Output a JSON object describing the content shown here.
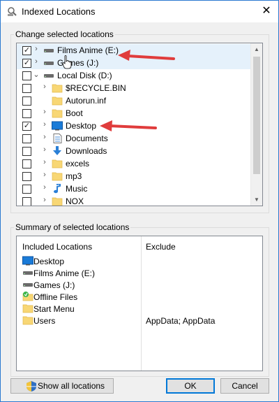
{
  "window": {
    "title": "Indexed Locations",
    "close_glyph": "✕"
  },
  "change_group": {
    "label": "Change selected locations"
  },
  "tree": {
    "rows": [
      {
        "label": "Films Anime (E:)",
        "checked": true,
        "expander": "›",
        "icon": "drive-icon",
        "indent": 1
      },
      {
        "label": "Games (J:)",
        "checked": true,
        "expander": "›",
        "icon": "drive-icon",
        "indent": 1
      },
      {
        "label": "Local Disk (D:)",
        "checked": false,
        "expander": "⌄",
        "icon": "drive-icon",
        "indent": 1
      },
      {
        "label": "$RECYCLE.BIN",
        "checked": false,
        "expander": "›",
        "icon": "folder-icon",
        "indent": 2
      },
      {
        "label": "Autorun.inf",
        "checked": false,
        "expander": "",
        "icon": "folder-icon",
        "indent": 2
      },
      {
        "label": "Boot",
        "checked": false,
        "expander": "›",
        "icon": "folder-icon",
        "indent": 2
      },
      {
        "label": "Desktop",
        "checked": true,
        "expander": "›",
        "icon": "desktop-icon",
        "indent": 2
      },
      {
        "label": "Documents",
        "checked": false,
        "expander": "›",
        "icon": "documents-icon",
        "indent": 2
      },
      {
        "label": "Downloads",
        "checked": false,
        "expander": "›",
        "icon": "downloads-icon",
        "indent": 2
      },
      {
        "label": "excels",
        "checked": false,
        "expander": "›",
        "icon": "folder-icon",
        "indent": 2
      },
      {
        "label": "mp3",
        "checked": false,
        "expander": "›",
        "icon": "folder-icon",
        "indent": 2
      },
      {
        "label": "Music",
        "checked": false,
        "expander": "›",
        "icon": "music-icon",
        "indent": 2
      },
      {
        "label": "NOX",
        "checked": false,
        "expander": "›",
        "icon": "folder-icon",
        "indent": 2
      }
    ],
    "check_glyph": "✓",
    "scroll_up_glyph": "▲",
    "scroll_down_glyph": "▼"
  },
  "summary_group": {
    "label": "Summary of selected locations"
  },
  "summary": {
    "included_header": "Included Locations",
    "exclude_header": "Exclude",
    "items": [
      {
        "label": "Desktop",
        "icon": "desktop-icon",
        "exclude": ""
      },
      {
        "label": "Films Anime (E:)",
        "icon": "drive-icon",
        "exclude": ""
      },
      {
        "label": "Games (J:)",
        "icon": "drive-icon",
        "exclude": ""
      },
      {
        "label": "Offline Files",
        "icon": "offline-files-icon",
        "exclude": ""
      },
      {
        "label": "Start Menu",
        "icon": "folder-icon",
        "exclude": ""
      },
      {
        "label": "Users",
        "icon": "folder-icon",
        "exclude": "AppData; AppData"
      }
    ]
  },
  "buttons": {
    "show_all": "Show all locations",
    "ok": "OK",
    "cancel": "Cancel"
  },
  "colors": {
    "annotation_arrow": "#e03c3c",
    "window_border": "#2b79d0",
    "highlight_row": "#e5f1fb"
  }
}
